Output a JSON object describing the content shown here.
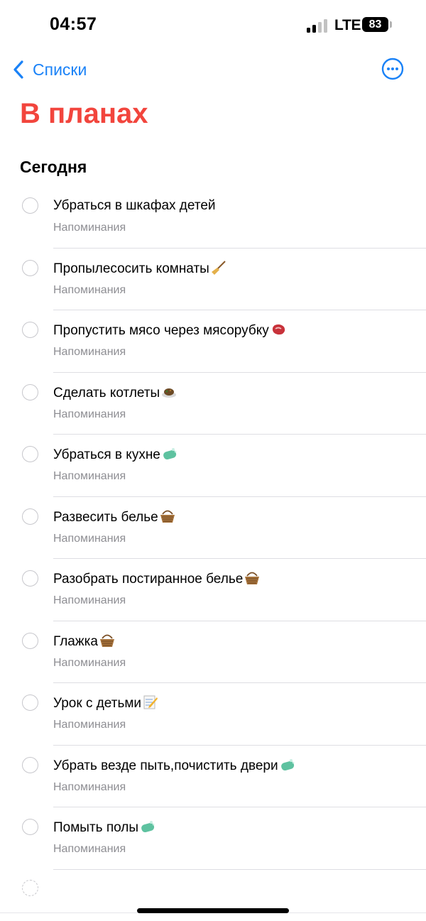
{
  "status_bar": {
    "time": "04:57",
    "network": "LTE",
    "battery": "83"
  },
  "nav": {
    "back_label": "Списки",
    "back_icon": "chevron-left-icon",
    "more_icon": "ellipsis-circle-icon",
    "accent": "#1a82f7"
  },
  "title": {
    "text": "В планах",
    "color": "#f2453d"
  },
  "section": {
    "title": "Сегодня"
  },
  "items": [
    {
      "title": "Убраться в шкафах детей",
      "list": "Напоминания",
      "emoji": ""
    },
    {
      "title": "Пропылесосить комнаты",
      "list": "Напоминания",
      "emoji": "broom-emoji"
    },
    {
      "title": "Пропустить мясо через мясорубку",
      "list": "Напоминания",
      "emoji": "meat-emoji"
    },
    {
      "title": "Сделать котлеты",
      "list": "Напоминания",
      "emoji": "food-plate-emoji"
    },
    {
      "title": "Убраться в кухне",
      "list": "Напоминания",
      "emoji": "soap-emoji"
    },
    {
      "title": "Развесить белье",
      "list": "Напоминания",
      "emoji": "basket-emoji"
    },
    {
      "title": "Разобрать постиранное белье",
      "list": "Напоминания",
      "emoji": "basket-emoji"
    },
    {
      "title": "Глажка",
      "list": "Напоминания",
      "emoji": "basket-emoji"
    },
    {
      "title": "Урок с детьми",
      "list": "Напоминания",
      "emoji": "memo-emoji"
    },
    {
      "title": "Убрать везде пыть,почистить двери",
      "list": "Напоминания",
      "emoji": "soap-emoji"
    },
    {
      "title": "Помыть полы",
      "list": "Напоминания",
      "emoji": "soap-emoji"
    }
  ]
}
